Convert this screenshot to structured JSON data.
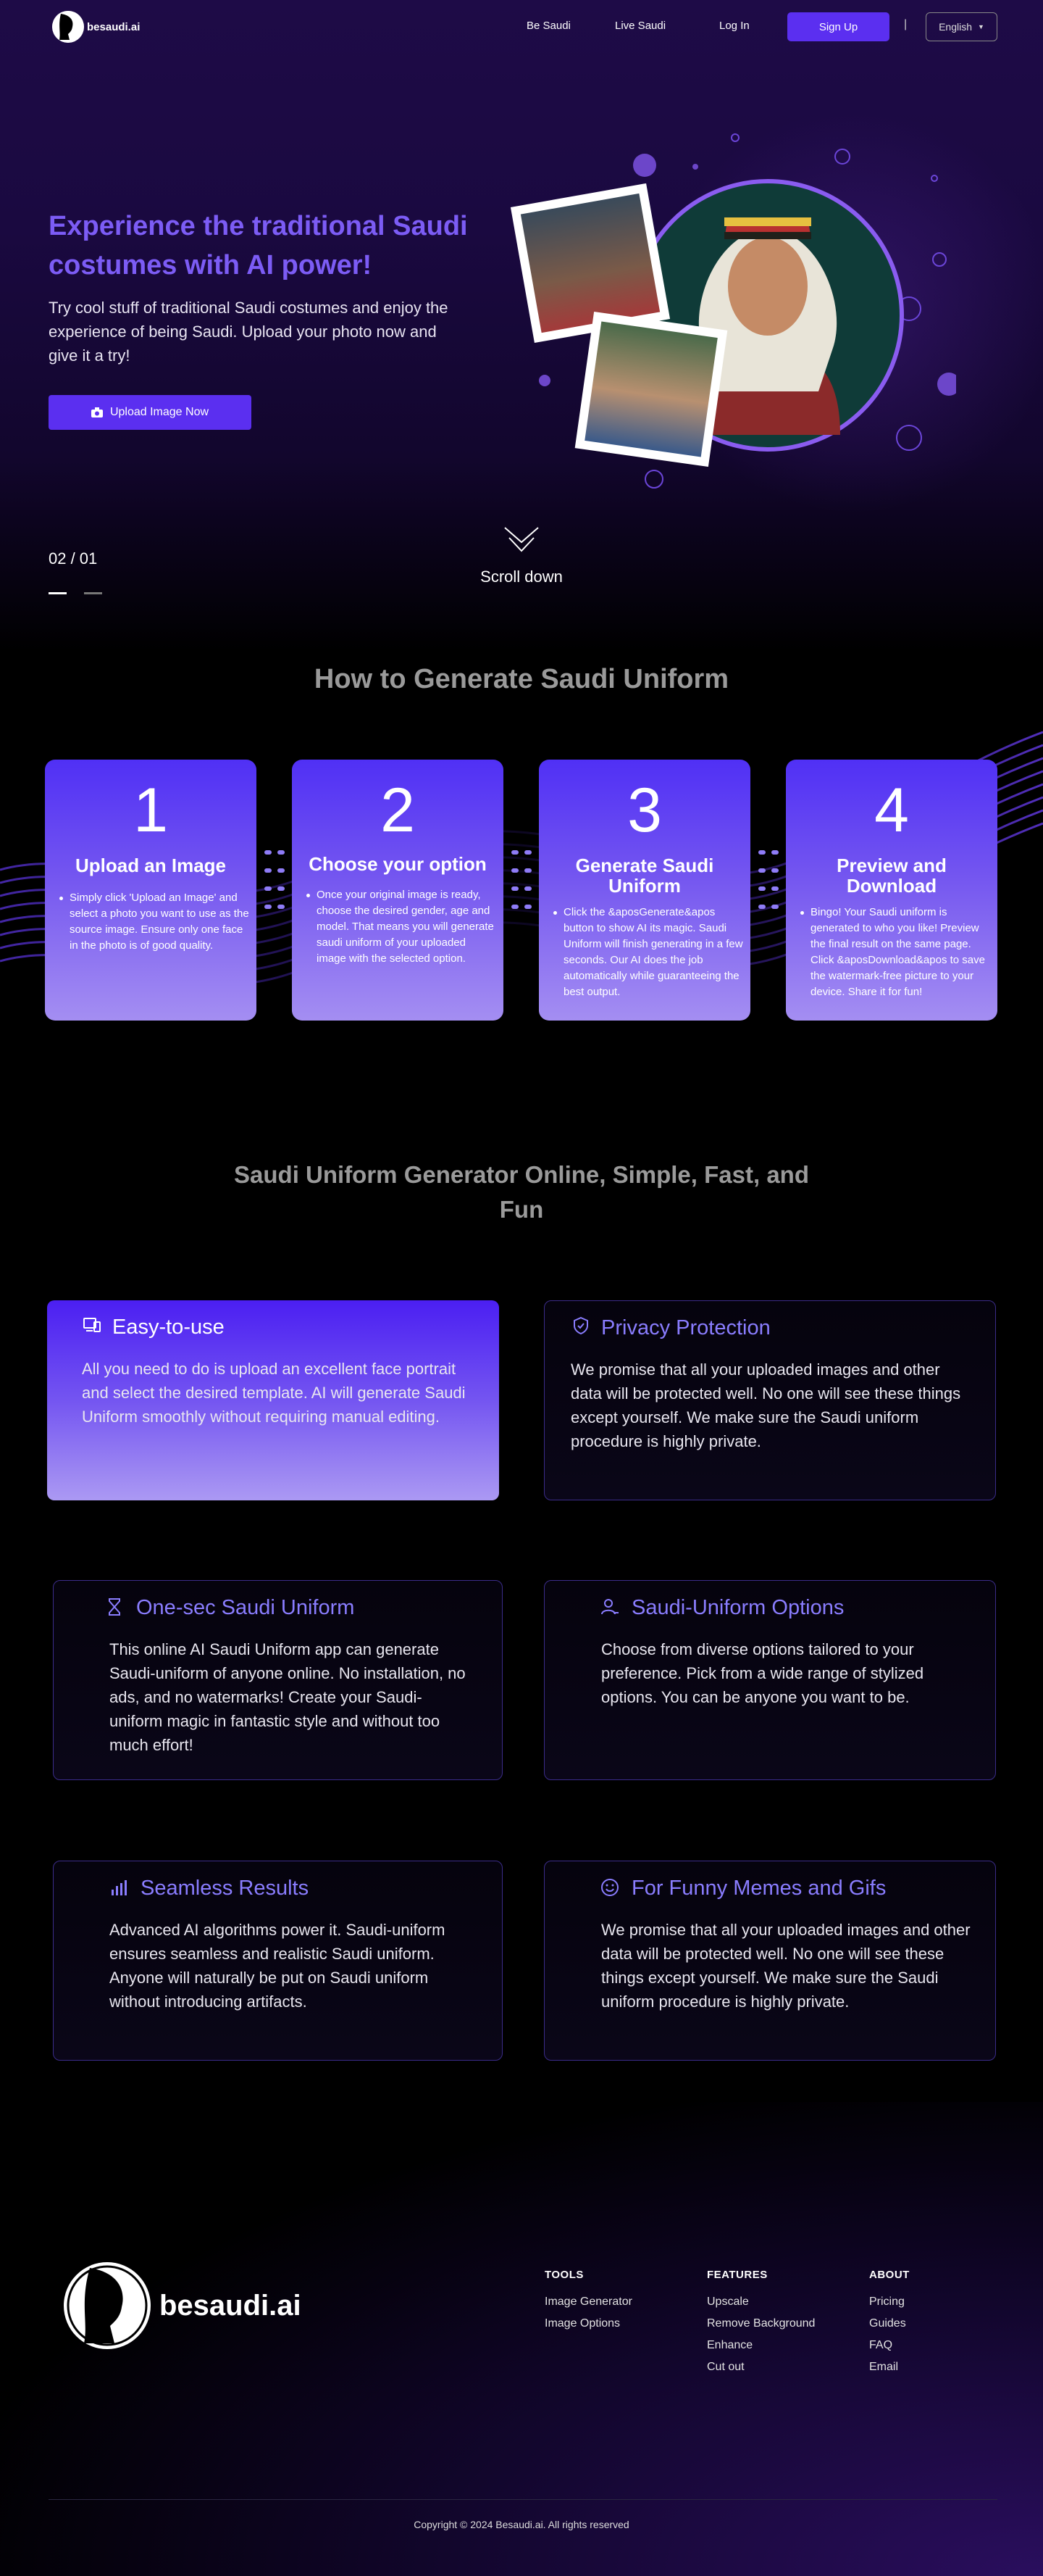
{
  "nav": {
    "brand": "besaudi.ai",
    "links": [
      "Be Saudi",
      "Live Saudi",
      "Log In"
    ],
    "signup": "Sign Up",
    "separator": "|",
    "language": "English"
  },
  "hero": {
    "title": "Experience the traditional Saudi costumes with AI power!",
    "subtitle": "Try cool stuff of traditional Saudi costumes and enjoy the experience of being Saudi. Upload your photo now and give it a try!",
    "upload_button": "Upload Image Now",
    "slide_counter": "02 / 01",
    "scroll_label": "Scroll down"
  },
  "how": {
    "title": "How to Generate Saudi Uniform",
    "steps": [
      {
        "num": "1",
        "title": "Upload an Image",
        "text": "Simply click 'Upload an Image' and select a photo you want to use as the source image. Ensure only one face in the photo is of good quality."
      },
      {
        "num": "2",
        "title": "Choose your option",
        "text": "Once your original image is ready, choose the desired gender, age and model. That means you will generate saudi uniform of your uploaded image with the selected option."
      },
      {
        "num": "3",
        "title": "Generate Saudi Uniform",
        "text": "Click the &aposGenerate&apos button to show AI its magic. Saudi Uniform will finish generating in a few seconds. Our AI does the job automatically while guaranteeing the best output."
      },
      {
        "num": "4",
        "title": "Preview and Download",
        "text": "Bingo! Your Saudi uniform is generated to who you like! Preview the final result on the same page. Click &aposDownload&apos to save the watermark-free picture to your device. Share it for fun!"
      }
    ]
  },
  "features": {
    "title": "Saudi Uniform Generator Online, Simple, Fast, and Fun",
    "cards": [
      {
        "title": "Easy-to-use",
        "icon": "devices-icon",
        "text": "All you need to do is upload an excellent face portrait and select the desired template. AI will generate Saudi Uniform smoothly without requiring manual editing."
      },
      {
        "title": "Privacy Protection",
        "icon": "shield-check-icon",
        "text": "We promise that all your uploaded images and other data will be protected well. No one will see these things except yourself. We make sure the Saudi uniform procedure is highly private."
      },
      {
        "title": "One-sec Saudi Uniform",
        "icon": "hourglass-icon",
        "text": "This online AI Saudi Uniform app can generate Saudi-uniform of anyone online. No installation, no ads, and no watermarks! Create your Saudi-uniform magic in fantastic style and without too much effort!"
      },
      {
        "title": "Saudi-Uniform Options",
        "icon": "user-options-icon",
        "text": "Choose from diverse options tailored to your preference. Pick from a wide range of stylized options. You can be anyone you want to be."
      },
      {
        "title": "Seamless Results",
        "icon": "bar-chart-icon",
        "text": "Advanced AI algorithms power it. Saudi-uniform ensures seamless and realistic Saudi uniform. Anyone will naturally be put on Saudi uniform without introducing artifacts."
      },
      {
        "title": "For Funny Memes and Gifs",
        "icon": "smile-icon",
        "text": "We promise that all your uploaded images and other data will be protected well. No one will see these things except yourself. We make sure the Saudi uniform procedure is highly private."
      }
    ]
  },
  "footer": {
    "brand": "besaudi.ai",
    "columns": [
      {
        "title": "TOOLS",
        "links": [
          "Image Generator",
          "Image Options"
        ]
      },
      {
        "title": "FEATURES",
        "links": [
          "Upscale",
          "Remove Background",
          "Enhance",
          "Cut out"
        ]
      },
      {
        "title": "ABOUT",
        "links": [
          "Pricing",
          "Guides",
          "FAQ",
          "Email"
        ]
      }
    ],
    "copyright": "Copyright © 2024 Besaudi.ai. All rights reserved"
  },
  "colors": {
    "accent": "#5b2ff0",
    "title_purple": "#7c5cf5",
    "card_border": "#3b2c8a"
  }
}
